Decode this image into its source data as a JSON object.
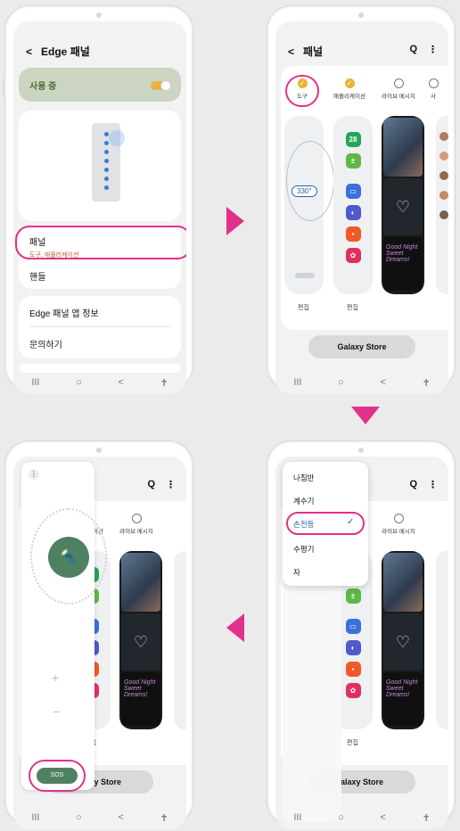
{
  "screen1": {
    "title": "Edge 패널",
    "toggle_label": "사용 중",
    "panel_label": "패널",
    "panel_sub": "도구, 애플리케이션",
    "handle_label": "핸들",
    "info_label": "Edge 패널 앱 정보",
    "contact_label": "문의하기"
  },
  "screen2": {
    "title": "패널",
    "tabs": [
      {
        "label": "도구",
        "checked": true
      },
      {
        "label": "애플리케이션",
        "checked": true
      },
      {
        "label": "라이브 메시지",
        "checked": false
      },
      {
        "label": "사"
      }
    ],
    "compass_value": "330°",
    "edit_label": "편집",
    "store_label": "Galaxy Store",
    "photo_text": "Good Night Sweet Dreams!"
  },
  "screen3": {
    "menu_items": [
      "나침반",
      "계수기",
      "손전등",
      "수평기",
      "자"
    ],
    "selected": "손전등",
    "store_label": "alaxy Store",
    "edit_label": "편집"
  },
  "screen4": {
    "sos_label": "SOS",
    "store_label": "alaxy Store",
    "edit_label": "편집"
  },
  "nav": {
    "recent": "III",
    "home": "○",
    "back": "<",
    "access": "⚲"
  },
  "colors": {
    "accent_pink": "#e2318a",
    "toggle": "#e8b433",
    "flash_green": "#4f8061"
  }
}
